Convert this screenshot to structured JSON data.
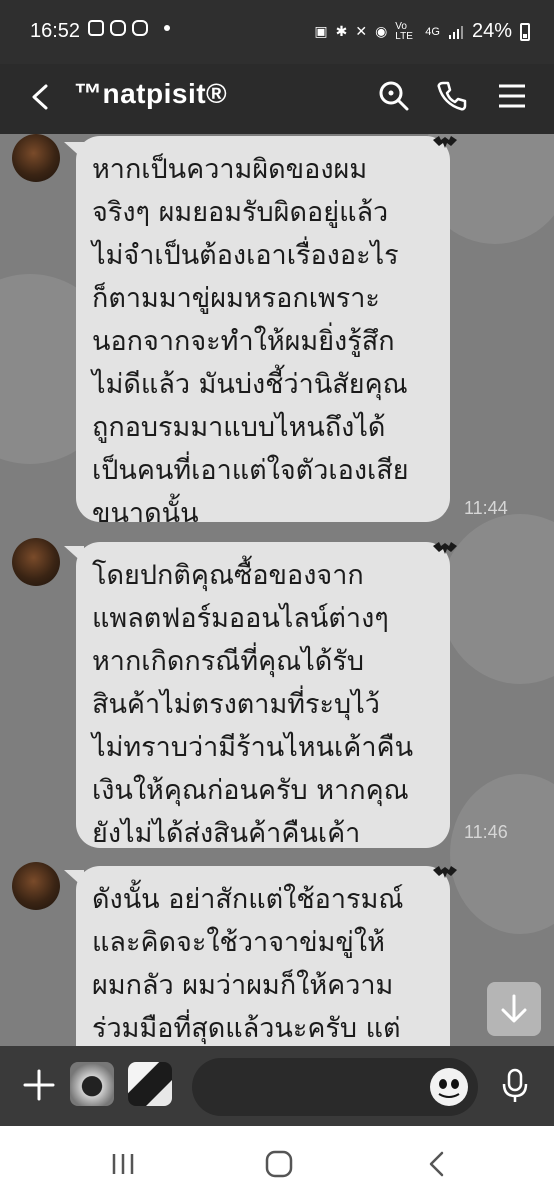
{
  "status_bar": {
    "time": "16:52",
    "network": "4G",
    "volte": "Vo LTE",
    "battery": "24%"
  },
  "header": {
    "title": "™natpisit®",
    "back_icon": "back-arrow-icon",
    "search_icon": "search-icon",
    "call_icon": "phone-icon",
    "menu_icon": "menu-icon"
  },
  "messages": [
    {
      "lines": [
        "หากเป็นความผิดของผม",
        "จริงๆ ผมยอมรับผิดอยู่แล้ว",
        "ไม่จำเป็นต้องเอาเรื่องอะไร",
        "ก็ตามมาขู่ผมหรอกเพราะ",
        "นอกจากจะทำให้ผมยิ่งรู้สึก",
        "ไม่ดีแล้ว มันบ่งชี้ว่านิสัยคุณ",
        "ถูกอบรมมาแบบไหนถึงได้",
        "เป็นคนที่เอาแต่ใจตัวเองเสีย",
        "ขนาดนั้น"
      ],
      "time": "11:44"
    },
    {
      "lines": [
        "โดยปกติคุณซื้อของจาก",
        "แพลตฟอร์มออนไลน์ต่างๆ",
        "หากเกิดกรณีที่คุณได้รับ",
        "สินค้าไม่ตรงตามที่ระบุไว้",
        "ไม่ทราบว่ามีร้านไหนเค้าคืน",
        "เงินให้คุณก่อนครับ หากคุณ",
        "ยังไม่ได้ส่งสินค้าคืนเค้า"
      ],
      "time": "11:46"
    },
    {
      "lines": [
        "ดังนั้น อย่าสักแต่ใช้อารมณ์",
        "และคิดจะใช้วาจาข่มขู่ให้",
        "ผมกลัว ผมว่าผมก็ให้ความ",
        "ร่วมมือที่สุดแล้วนะครับ แต่"
      ]
    }
  ],
  "input_bar": {
    "plus_icon": "plus-icon",
    "mic_icon": "microphone-icon",
    "emoji_icon": "emoji-face-icon"
  },
  "nav_bar": {
    "recents_icon": "recents-icon",
    "home_icon": "home-icon",
    "back_icon": "nav-back-icon"
  }
}
